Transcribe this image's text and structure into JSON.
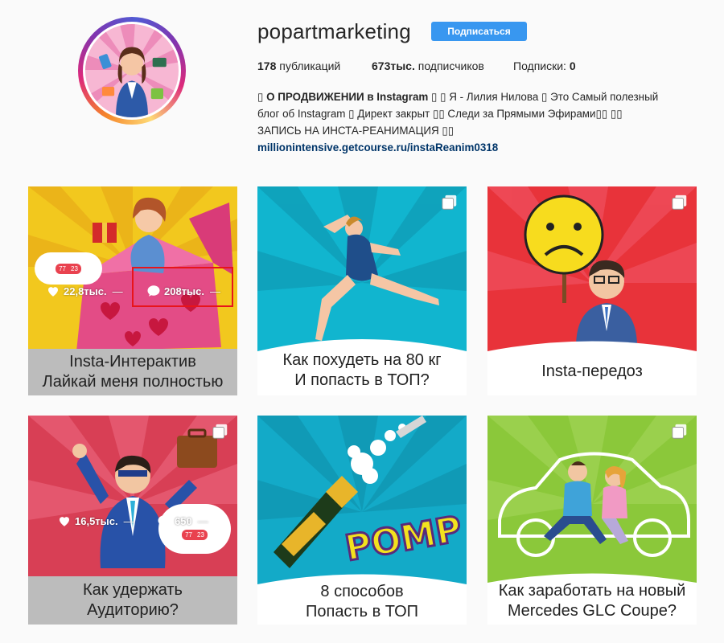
{
  "profile": {
    "username": "popartmarketing",
    "follow_label": "Подписаться",
    "stats": {
      "posts_count": "178",
      "posts_label": "публикаций",
      "followers_count": "673тыс.",
      "followers_label": "подписчиков",
      "following_label": "Подписки:",
      "following_count": "0"
    },
    "bio": {
      "line1_bold": "▯ О ПРОДВИЖЕНИИ в Instagram",
      "line1_rest": " ▯ ▯ Я - Лилия Нилова ▯ Это Самый полезный",
      "line2": "блог об Instagram ▯ Директ закрыт ▯▯ Следи за Прямыми Эфирами▯▯ ▯▯",
      "line3": "ЗАПИСЬ НА ИНСТА-РЕАНИМАЦИЯ ▯▯",
      "link": "millionintensive.getcourse.ru/instaReanim0318"
    }
  },
  "posts": [
    {
      "caption_line1": "Insta-Интерактив",
      "caption_line2": "Лайкай меня полностью",
      "likes": "22,8тыс.",
      "comments": "208тыс.",
      "bubble_likes": "77",
      "bubble_followers": "23"
    },
    {
      "caption_line1": "Как похудеть на 80 кг",
      "caption_line2": "И попасть в ТОП?"
    },
    {
      "caption_line1": "Insta-передоз"
    },
    {
      "caption_line1": "Как удержать",
      "caption_line2": "Аудиторию?",
      "likes": "16,5тыс.",
      "comments": "650",
      "bubble_likes": "77",
      "bubble_followers": "23"
    },
    {
      "caption_line1": "8 способов",
      "caption_line2": "Попасть в ТОП",
      "art_text": "POMP"
    },
    {
      "caption_line1": "Как заработать на новый",
      "caption_line2": "Mercedes GLC Coupe?"
    }
  ],
  "icons": {
    "heart": "heart-icon",
    "comment": "comment-icon",
    "multi": "carousel-icon"
  },
  "colors": {
    "follow_button": "#3897f0",
    "link": "#003569",
    "highlight": "#e8141b"
  }
}
